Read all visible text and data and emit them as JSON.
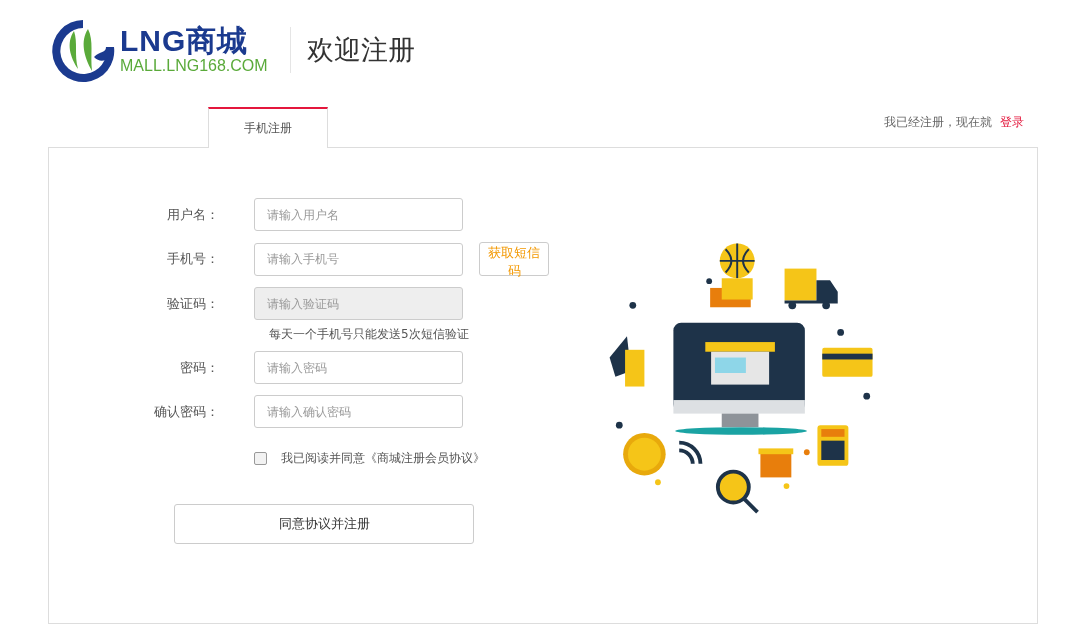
{
  "logo": {
    "brand": "LNG商城",
    "url": "MALL.LNG168.COM"
  },
  "page_title": "欢迎注册",
  "tabs": [
    {
      "label": "手机注册",
      "selected": true
    }
  ],
  "login_prompt": {
    "text": "我已经注册，现在就",
    "link": "登录"
  },
  "form": {
    "fields": [
      {
        "label": "用户名：",
        "placeholder": "请输入用户名",
        "disabled": false
      },
      {
        "label": "手机号：",
        "placeholder": "请输入手机号",
        "disabled": false,
        "button": "获取短信码"
      },
      {
        "label": "验证码：",
        "placeholder": "请输入验证码",
        "disabled": true,
        "hint": "每天一个手机号只能发送5次短信验证"
      },
      {
        "label": "密码：",
        "placeholder": "请输入密码",
        "disabled": false
      },
      {
        "label": "确认密码：",
        "placeholder": "请输入确认密码",
        "disabled": false
      }
    ],
    "agreement": {
      "text": "我已阅读并同意《商城注册会员协议》",
      "checked": false
    },
    "submit": "同意协议并注册"
  }
}
